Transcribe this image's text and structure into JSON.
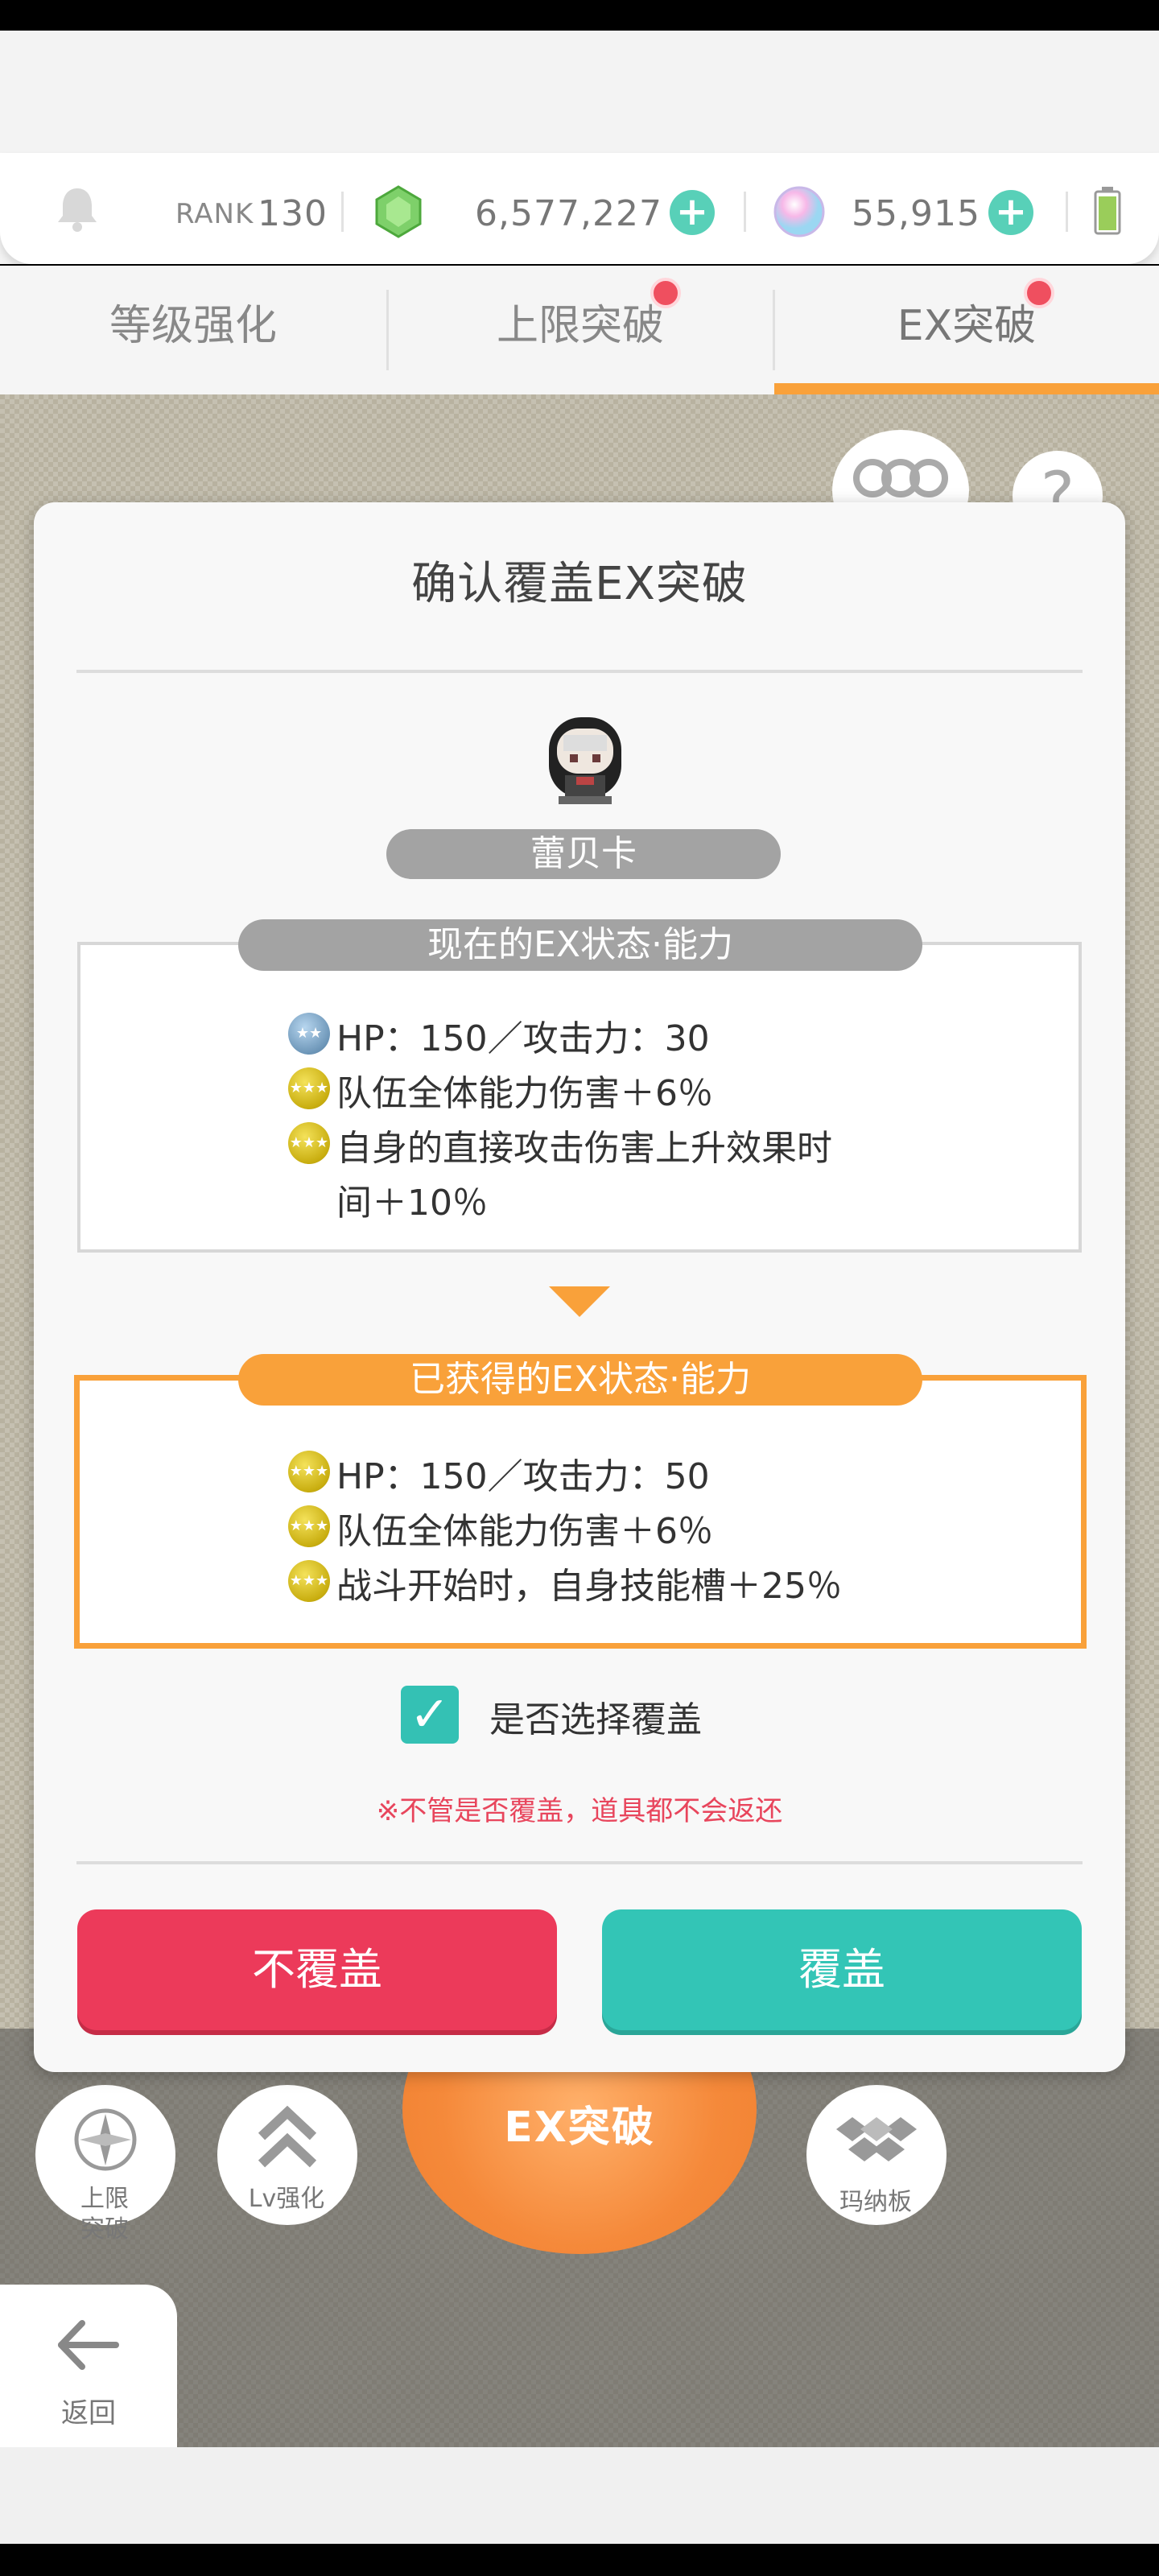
{
  "resource_bar": {
    "rank_label": "RANK",
    "rank_value": "130",
    "gems": "6,577,227",
    "crystals": "55,915"
  },
  "tabs": [
    {
      "label": "等级强化"
    },
    {
      "label": "上限突破"
    },
    {
      "label": "EX突破"
    }
  ],
  "dialog": {
    "title": "确认覆盖EX突破",
    "character_name": "蕾贝卡",
    "current_header": "现在的EX状态·能力",
    "current_lines": [
      "HP：150／攻击力：30",
      "队伍全体能力伤害＋6％",
      "自身的直接攻击伤害上升效果时",
      "间＋10％"
    ],
    "new_header": "已获得的EX状态·能力",
    "new_lines": [
      "HP：150／攻击力：50",
      "队伍全体能力伤害＋6％",
      "战斗开始时，自身技能槽＋25％"
    ],
    "checkbox_label": "是否选择覆盖",
    "checkbox_checked": true,
    "warning": "※不管是否覆盖，道具都不会返还",
    "cancel_label": "不覆盖",
    "confirm_label": "覆盖"
  },
  "bottom_nav": {
    "limit_break_line1": "上限",
    "limit_break_line2": "突破",
    "level_up": "Lv强化",
    "ex_break": "EX突破",
    "mana_board": "玛纳板",
    "back": "返回"
  },
  "colors": {
    "accent_orange": "#f9a13a",
    "cancel_red": "#ec3a5a",
    "confirm_teal": "#33c5b6"
  }
}
